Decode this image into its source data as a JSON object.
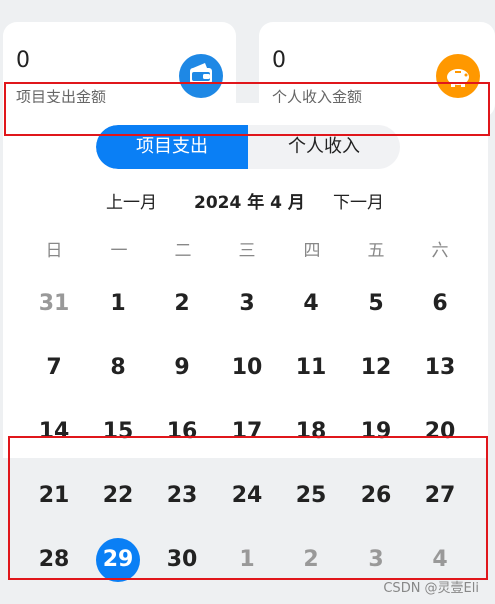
{
  "summary": {
    "expense": {
      "amount": "0",
      "label": "项目支出金额",
      "icon": "wallet-icon",
      "color": "#1e88e5"
    },
    "income": {
      "amount": "0",
      "label": "个人收入金额",
      "icon": "piggy-bank-icon",
      "color": "#ff9800"
    }
  },
  "tabs": [
    {
      "label": "项目支出",
      "active": true
    },
    {
      "label": "个人收入",
      "active": false
    }
  ],
  "calendar": {
    "prev_label": "上一月",
    "title": "2024 年 4 月",
    "next_label": "下一月",
    "weekdays": [
      "日",
      "一",
      "二",
      "三",
      "四",
      "五",
      "六"
    ],
    "weeks": [
      [
        "31",
        "1",
        "2",
        "3",
        "4",
        "5",
        "6"
      ],
      [
        "7",
        "8",
        "9",
        "10",
        "11",
        "12",
        "13"
      ],
      [
        "14",
        "15",
        "16",
        "17",
        "18",
        "19",
        "20"
      ],
      [
        "21",
        "22",
        "23",
        "24",
        "25",
        "26",
        "27"
      ],
      [
        "28",
        "29",
        "30",
        "1",
        "2",
        "3",
        "4"
      ]
    ],
    "selected": "29",
    "accent": "#0a7ff5"
  },
  "watermark": "CSDN @灵壹Eli"
}
